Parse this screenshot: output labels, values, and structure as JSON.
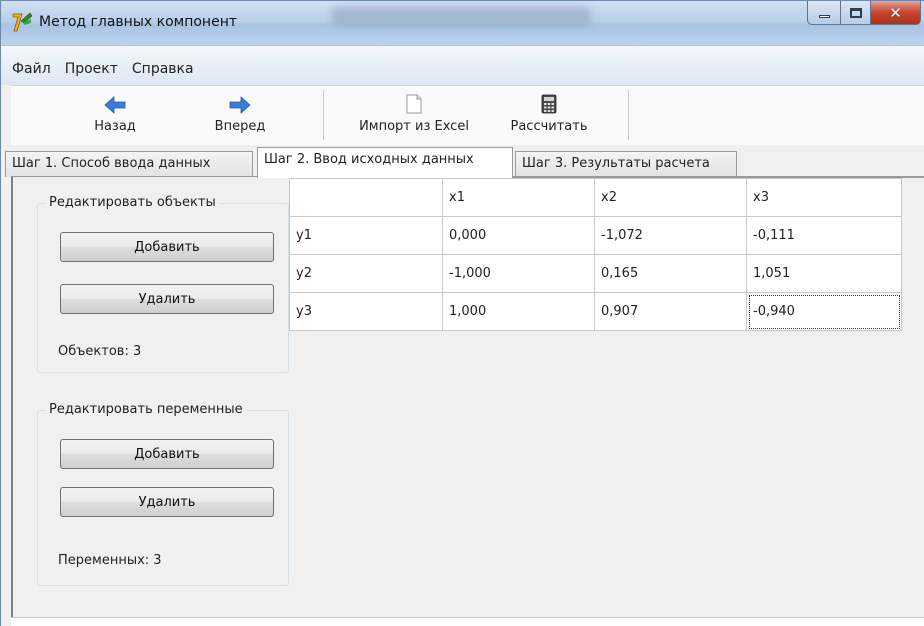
{
  "window": {
    "title": "Метод главных компонент"
  },
  "menu": {
    "items": [
      "Файл",
      "Проект",
      "Справка"
    ]
  },
  "toolbar": {
    "back_label": "Назад",
    "forward_label": "Вперед",
    "import_label": "Импорт из Excel",
    "calculate_label": "Рассчитать",
    "icons": {
      "back": "arrow-left-icon",
      "forward": "arrow-right-icon",
      "import": "document-icon",
      "calculate": "calculator-icon"
    },
    "arrow_color": "#3b7fd4"
  },
  "tabs": [
    {
      "label": "Шаг 1. Способ ввода данных",
      "active": false
    },
    {
      "label": "Шаг 2. Ввод исходных данных",
      "active": true
    },
    {
      "label": "Шаг 3. Результаты расчета",
      "active": false
    }
  ],
  "objects_group": {
    "title": "Редактировать объекты",
    "add_label": "Добавить",
    "delete_label": "Удалить",
    "count_text": "Объектов: 3"
  },
  "variables_group": {
    "title": "Редактировать переменные",
    "add_label": "Добавить",
    "delete_label": "Удалить",
    "count_text": "Переменных: 3"
  },
  "grid": {
    "columns": [
      "",
      "x1",
      "x2",
      "x3"
    ],
    "rows": [
      {
        "label": "y1",
        "values": [
          "0,000",
          "-1,072",
          "-0,111"
        ]
      },
      {
        "label": "y2",
        "values": [
          "-1,000",
          "0,165",
          "1,051"
        ]
      },
      {
        "label": "y3",
        "values": [
          "1,000",
          "0,907",
          "-0,940"
        ]
      }
    ],
    "selected_cell": "y3-x3"
  }
}
